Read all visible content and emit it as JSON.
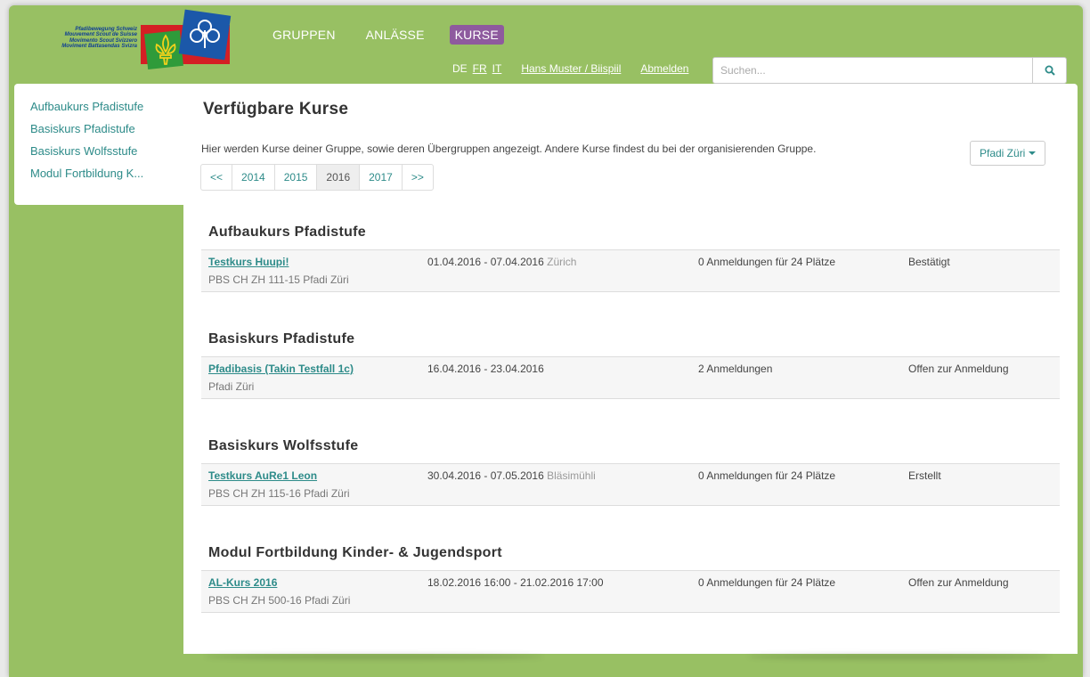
{
  "logo": {
    "lines": [
      "Pfadibewegung Schweiz",
      "Mouvement Scout de Suisse",
      "Movimento Scout Svizzero",
      "Moviment Battasendas Svizra"
    ]
  },
  "topnav": [
    {
      "label": "GRUPPEN",
      "active": false
    },
    {
      "label": "ANLÄSSE",
      "active": false
    },
    {
      "label": "KURSE",
      "active": true
    }
  ],
  "userbar": {
    "lang_de": "DE",
    "lang_fr": "FR",
    "lang_it": "IT",
    "user": "Hans Muster / Biispiil",
    "logout": "Abmelden"
  },
  "search": {
    "placeholder": "Suchen...",
    "icon": "search-icon"
  },
  "sidebar": {
    "items": [
      "Aufbaukurs Pfadistufe",
      "Basiskurs Pfadistufe",
      "Basiskurs Wolfsstufe",
      "Modul Fortbildung K..."
    ]
  },
  "main": {
    "title": "Verfügbare Kurse",
    "intro": "Hier werden Kurse deiner Gruppe, sowie deren Übergruppen angezeigt. Andere Kurse findest du bei der organisierenden Gruppe.",
    "group_button": "Pfadi Züri",
    "years": [
      "<<",
      "2014",
      "2015",
      "2016",
      "2017",
      ">>"
    ],
    "active_year": "2016"
  },
  "sections": [
    {
      "title": "Aufbaukurs Pfadistufe",
      "course": {
        "name": "Testkurs Huupi!",
        "group": "PBS CH ZH 111-15 Pfadi Züri",
        "date": "01.04.2016 - 07.04.2016",
        "location": "Zürich",
        "registrations": "0 Anmeldungen für 24 Plätze",
        "state": "Bestätigt"
      }
    },
    {
      "title": "Basiskurs Pfadistufe",
      "course": {
        "name": "Pfadibasis (Takin Testfall 1c)",
        "group": "Pfadi Züri",
        "date": "16.04.2016 - 23.04.2016",
        "location": "",
        "registrations": "2 Anmeldungen",
        "state": "Offen zur Anmeldung"
      }
    },
    {
      "title": "Basiskurs Wolfsstufe",
      "course": {
        "name": "Testkurs AuRe1 Leon",
        "group": "PBS CH ZH 115-16 Pfadi Züri",
        "date": "30.04.2016 - 07.05.2016",
        "location": "Bläsimühli",
        "registrations": "0 Anmeldungen für 24 Plätze",
        "state": "Erstellt"
      }
    },
    {
      "title": "Modul Fortbildung Kinder- & Jugendsport",
      "course": {
        "name": "AL-Kurs 2016",
        "group": "PBS CH ZH 500-16 Pfadi Züri",
        "date": "18.02.2016 16:00 - 21.02.2016 17:00",
        "location": "",
        "registrations": "0 Anmeldungen für 24 Plätze",
        "state": "Offen zur Anmeldung"
      }
    }
  ],
  "colors": {
    "accent": "#2d8b89",
    "background": "#98c063",
    "active_nav": "#8e5a9e"
  }
}
